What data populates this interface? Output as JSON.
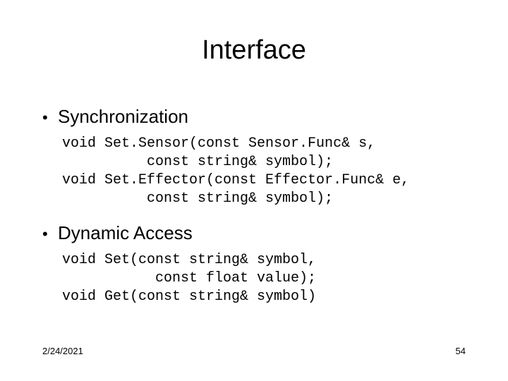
{
  "title": "Interface",
  "sections": [
    {
      "heading": "Synchronization",
      "code": "void Set.Sensor(const Sensor.Func& s,\n          const string& symbol);\nvoid Set.Effector(const Effector.Func& e,\n          const string& symbol);"
    },
    {
      "heading": "Dynamic Access",
      "code": "void Set(const string& symbol,\n           const float value);\nvoid Get(const string& symbol)"
    }
  ],
  "footer": {
    "date": "2/24/2021",
    "page": "54"
  }
}
